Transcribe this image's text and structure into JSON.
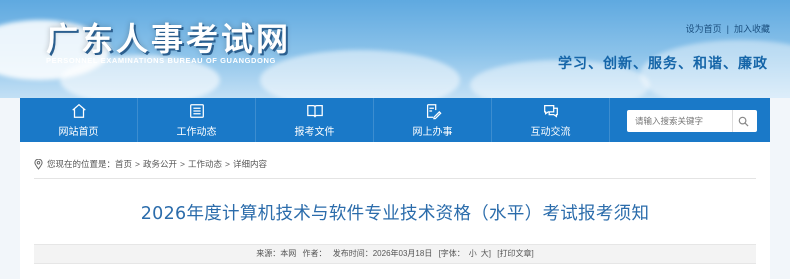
{
  "header": {
    "logo_cn": "广东人事考试网",
    "logo_en": "PERSONNEL EXAMINATIONS BUREAU OF GUANGDONG",
    "links": [
      "设为首页",
      "加入收藏"
    ],
    "link_separator": "|",
    "slogan": "学习、创新、服务、和谐、廉政"
  },
  "nav": {
    "items": [
      {
        "label": "网站首页",
        "icon": "home-icon"
      },
      {
        "label": "工作动态",
        "icon": "list-icon"
      },
      {
        "label": "报考文件",
        "icon": "book-icon"
      },
      {
        "label": "网上办事",
        "icon": "edit-document-icon"
      },
      {
        "label": "互动交流",
        "icon": "chat-icon"
      }
    ],
    "search": {
      "placeholder": "请输入搜索关键字",
      "icon": "search-icon"
    }
  },
  "breadcrumb": {
    "prefix": "您现在的位置是：",
    "items": [
      "首页",
      "政务公开",
      "工作动态",
      "详细内容"
    ],
    "separator": ">",
    "icon": "location-pin-icon"
  },
  "article": {
    "title": "2026年度计算机技术与软件专业技术资格（水平）考试报考须知",
    "meta": {
      "source": "来源：本网",
      "author": "作者：",
      "published": "发布时间：2026年03月18日",
      "font_label": "[字体：",
      "font_small": "小",
      "font_large": "大]",
      "print": "[打印文章]"
    }
  },
  "colors": {
    "nav_bg": "#1a79c8",
    "title": "#2b6cab",
    "slogan": "#1565a8"
  }
}
